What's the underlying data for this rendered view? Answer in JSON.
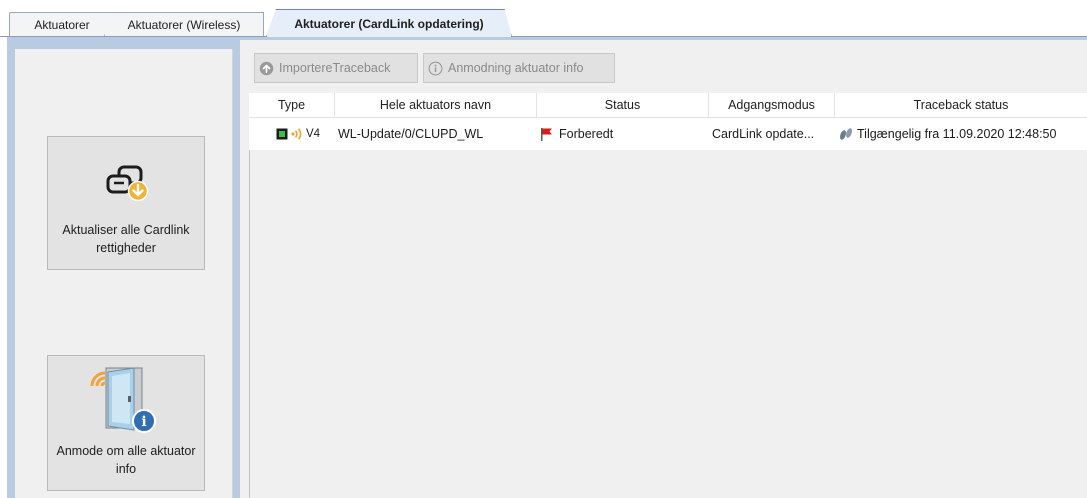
{
  "tabs": {
    "tab1": "Aktuatorer",
    "tab2": "Aktuatorer (Wireless)",
    "tab3": "Aktuatorer (CardLink opdatering)"
  },
  "left_buttons": {
    "update_all_label": "Aktualiser alle Cardlink rettigheder",
    "request_all_label": "Anmode om alle aktuator info"
  },
  "toolbar": {
    "import_label": "ImportereTraceback",
    "request_label": "Anmodning aktuator info"
  },
  "table": {
    "headers": [
      "Type",
      "Hele aktuators navn",
      "Status",
      "Adgangsmodus",
      "Traceback status"
    ],
    "rows": [
      {
        "type_label": "V4",
        "name": "WL-Update/0/CLUPD_WL",
        "status": "Forberedt",
        "access_mode": "CardLink  opdate...",
        "traceback": "Tilgængelig fra 11.09.2020 12:48:50"
      }
    ]
  },
  "colors": {
    "frame": "#b9cbe1",
    "active_tab": "#e6eef9",
    "flag": "#d81b1b",
    "download_badge": "#f2b233"
  }
}
